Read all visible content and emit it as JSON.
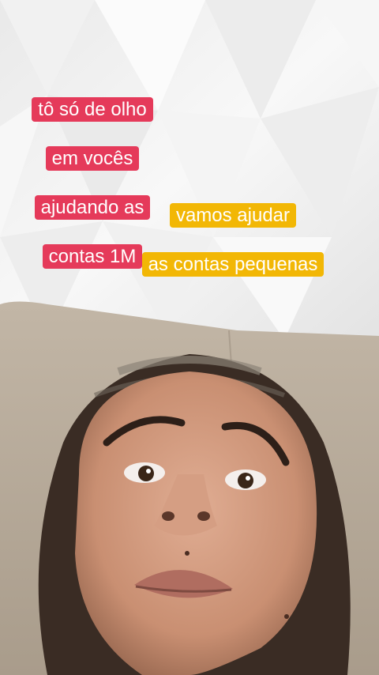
{
  "captions": {
    "red": {
      "lines": [
        "tô só de olho",
        "em vocês",
        "ajudando as",
        "contas 1M"
      ],
      "color": "#e53a5a"
    },
    "yellow": {
      "lines": [
        "vamos ajudar",
        "as contas pequenas"
      ],
      "color": "#f2b705"
    }
  },
  "photo": {
    "subject": "selfie-face-close-up",
    "background": "white-geometric-wall-and-beige-sofa"
  }
}
